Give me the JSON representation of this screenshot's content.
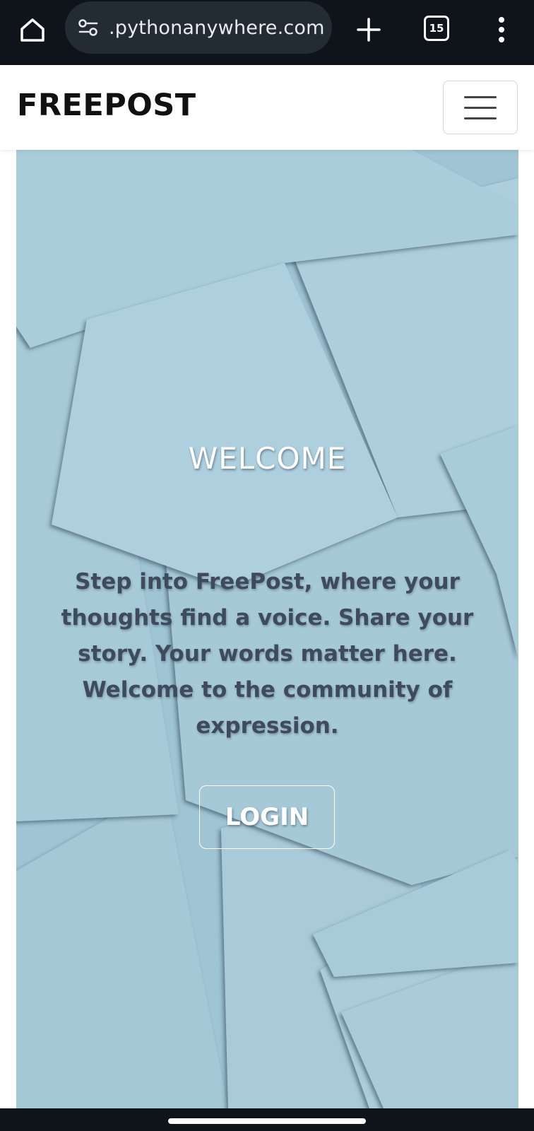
{
  "browser": {
    "url": ".pythonanywhere.com",
    "tab_count": "15",
    "icons": {
      "home": "home-icon",
      "site_settings": "tune-icon",
      "new_tab": "plus-icon",
      "tabs": "tab-switcher-icon",
      "menu": "more-vert-icon"
    }
  },
  "navbar": {
    "brand": "FREEPOST",
    "toggler_icon": "hamburger-icon"
  },
  "hero": {
    "title": "WELCOME",
    "intro": "Step into FreePost, where your thoughts find a voice. Share your story. Your words matter here. Welcome to the community of expression.",
    "login_label": "LOGIN"
  },
  "colors": {
    "chrome_bg": "#0f141b",
    "url_pill": "#232b35",
    "hero_paper": "#a9ccdb",
    "intro_text": "#3e4a5e",
    "brand_text": "#111111"
  }
}
